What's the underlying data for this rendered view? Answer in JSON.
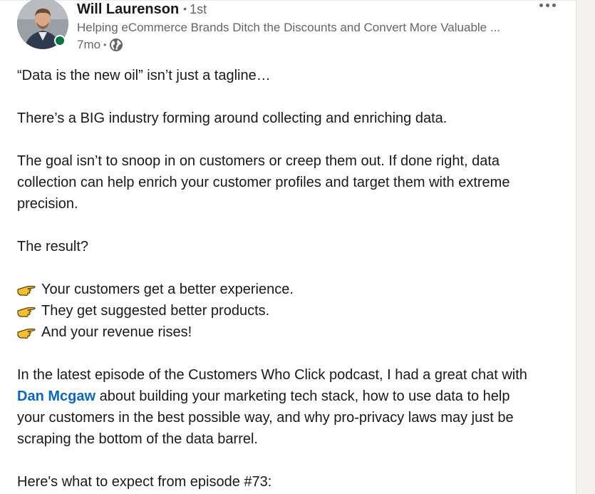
{
  "post": {
    "author": {
      "name": "Will Laurenson",
      "degree_separator": "•",
      "degree": "1st",
      "headline": "Helping eCommerce Brands Ditch the Discounts and Convert More Valuable ...",
      "age": "7mo",
      "meta_separator": "•",
      "visibility_icon": "globe-icon",
      "online_status_color": "#057642"
    },
    "more_options_icon": "ellipsis-icon",
    "lines": {
      "l1": "“Data is the new oil” isn’t just a tagline…",
      "l2": "There’s a BIG industry forming around collecting and enriching data.",
      "l3a": "The goal isn’t to snoop in on customers or creep them out. If done right, data",
      "l3b": "collection can help enrich your customer profiles and target them with extreme",
      "l3c": "precision.",
      "l4": "The result?",
      "b1": "Your customers get a better experience.",
      "b2": "They get suggested better products.",
      "b3": "And your revenue rises!",
      "p1a": "In the latest episode of the Customers Who Click podcast, I had a great chat with",
      "mention": "Dan Mcgaw",
      "p1b_rest": " about building your marketing tech stack,  how to use data to help",
      "p1c": "your customers in the best possible way, and why pro-privacy laws may just be",
      "p1d": "scraping the bottom of the data barrel.",
      "p2": "Here's what to expect from episode #73:"
    },
    "bullet_icon": "pointing-hand-icon",
    "colors": {
      "link": "#0a66c2",
      "secondary_text": "#666666",
      "bullet_hand": "#f4c030"
    }
  }
}
